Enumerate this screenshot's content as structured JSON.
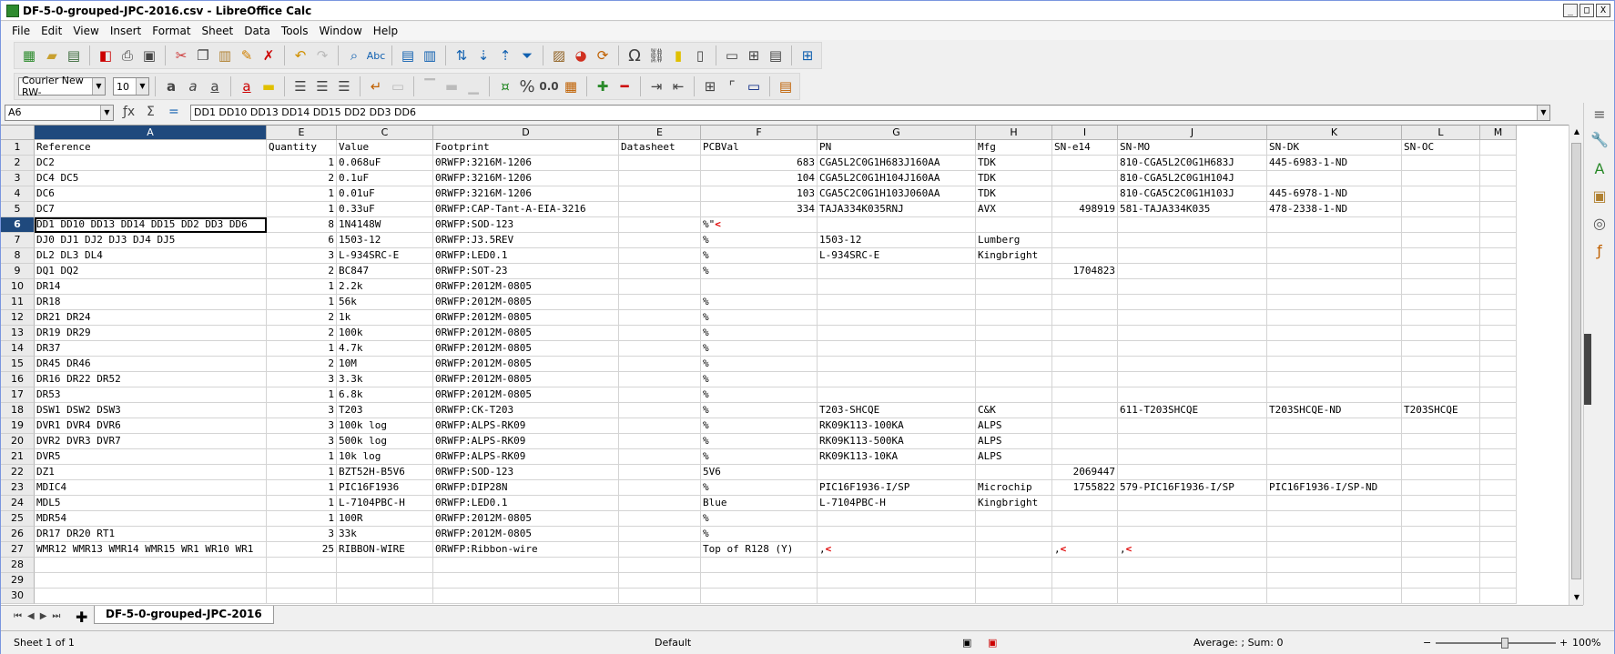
{
  "window": {
    "title": "DF-5-0-grouped-JPC-2016.csv - LibreOffice Calc",
    "min": "_",
    "max": "□",
    "close": "X"
  },
  "menu": [
    "File",
    "Edit",
    "View",
    "Insert",
    "Format",
    "Sheet",
    "Data",
    "Tools",
    "Window",
    "Help"
  ],
  "toolbar": {
    "font_name": "Courier New RW-",
    "font_size": "10",
    "percent": "%",
    "number": "0.0"
  },
  "formula_bar": {
    "cell_ref": "A6",
    "content": "DD1 DD10 DD13 DD14 DD15 DD2 DD3 DD6"
  },
  "columns": [
    {
      "label": "A",
      "w": 255
    },
    {
      "label": "E",
      "w": 77
    },
    {
      "label": "C",
      "w": 106
    },
    {
      "label": "D",
      "w": 204
    },
    {
      "label": "E",
      "w": 90
    },
    {
      "label": "F",
      "w": 128
    },
    {
      "label": "G",
      "w": 174
    },
    {
      "label": "H",
      "w": 84
    },
    {
      "label": "I",
      "w": 72
    },
    {
      "label": "J",
      "w": 164
    },
    {
      "label": "K",
      "w": 148
    },
    {
      "label": "L",
      "w": 86
    },
    {
      "label": "M",
      "w": 40
    }
  ],
  "rows": [
    [
      "Reference",
      "Quantity",
      "Value",
      "Footprint",
      "Datasheet",
      "PCBVal",
      "PN",
      "Mfg",
      "SN-e14",
      "SN-MO",
      "SN-DK",
      "SN-OC",
      ""
    ],
    [
      "DC2",
      "1",
      "0.068uF",
      "0RWFP:3216M-1206",
      "",
      "683",
      "CGA5L2C0G1H683J160AA",
      "TDK",
      "",
      "810-CGA5L2C0G1H683J",
      "445-6983-1-ND",
      "",
      ""
    ],
    [
      "DC4 DC5",
      "2",
      "0.1uF",
      "0RWFP:3216M-1206",
      "",
      "104",
      "CGA5L2C0G1H104J160AA",
      "TDK",
      "",
      "810-CGA5L2C0G1H104J",
      "",
      "",
      ""
    ],
    [
      "DC6",
      "1",
      "0.01uF",
      "0RWFP:3216M-1206",
      "",
      "103",
      "CGA5C2C0G1H103J060AA",
      "TDK",
      "",
      "810-CGA5C2C0G1H103J",
      "445-6978-1-ND",
      "",
      ""
    ],
    [
      "DC7",
      "1",
      "0.33uF",
      "0RWFP:CAP-Tant-A-EIA-3216",
      "",
      "334",
      "TAJA334K035RNJ",
      "AVX",
      "498919",
      "581-TAJA334K035",
      "478-2338-1-ND",
      "",
      ""
    ],
    [
      "DD1 DD10 DD13 DD14 DD15 DD2 DD3 DD6",
      "8",
      "1N4148W",
      "0RWFP:SOD-123",
      "",
      "%\"<",
      "",
      "",
      "",
      "",
      "",
      "",
      ""
    ],
    [
      "DJ0 DJ1 DJ2 DJ3 DJ4 DJ5",
      "6",
      "1503-12",
      "0RWFP:J3.5REV",
      "",
      "%",
      "1503-12",
      "Lumberg",
      "",
      "",
      "",
      "",
      ""
    ],
    [
      "DL2 DL3 DL4",
      "3",
      "L-934SRC-E",
      "0RWFP:LED0.1",
      "",
      "%",
      "L-934SRC-E",
      "Kingbright",
      "",
      "",
      "",
      "",
      ""
    ],
    [
      "DQ1 DQ2",
      "2",
      "BC847",
      "0RWFP:SOT-23",
      "",
      "%",
      "",
      "",
      "1704823",
      "",
      "",
      "",
      ""
    ],
    [
      "DR14",
      "1",
      "2.2k",
      "0RWFP:2012M-0805",
      "",
      "",
      "",
      "",
      "",
      "",
      "",
      "",
      ""
    ],
    [
      "DR18",
      "1",
      "56k",
      "0RWFP:2012M-0805",
      "",
      "%",
      "",
      "",
      "",
      "",
      "",
      "",
      ""
    ],
    [
      "DR21 DR24",
      "2",
      "1k",
      "0RWFP:2012M-0805",
      "",
      "%",
      "",
      "",
      "",
      "",
      "",
      "",
      ""
    ],
    [
      "DR19 DR29",
      "2",
      "100k",
      "0RWFP:2012M-0805",
      "",
      "%",
      "",
      "",
      "",
      "",
      "",
      "",
      ""
    ],
    [
      "DR37",
      "1",
      "4.7k",
      "0RWFP:2012M-0805",
      "",
      "%",
      "",
      "",
      "",
      "",
      "",
      "",
      ""
    ],
    [
      "DR45 DR46",
      "2",
      "10M",
      "0RWFP:2012M-0805",
      "",
      "%",
      "",
      "",
      "",
      "",
      "",
      "",
      ""
    ],
    [
      "DR16 DR22 DR52",
      "3",
      "3.3k",
      "0RWFP:2012M-0805",
      "",
      "%",
      "",
      "",
      "",
      "",
      "",
      "",
      ""
    ],
    [
      "DR53",
      "1",
      "6.8k",
      "0RWFP:2012M-0805",
      "",
      "%",
      "",
      "",
      "",
      "",
      "",
      "",
      ""
    ],
    [
      "DSW1 DSW2 DSW3",
      "3",
      "T203",
      "0RWFP:CK-T203",
      "",
      "%",
      "T203-SHCQE",
      "C&K",
      "",
      "611-T203SHCQE",
      "T203SHCQE-ND",
      "T203SHCQE",
      ""
    ],
    [
      "DVR1 DVR4 DVR6",
      "3",
      "100k log",
      "0RWFP:ALPS-RK09",
      "",
      "%",
      "RK09K113-100KA",
      "ALPS",
      "",
      "",
      "",
      "",
      ""
    ],
    [
      "DVR2 DVR3 DVR7",
      "3",
      "500k log",
      "0RWFP:ALPS-RK09",
      "",
      "%",
      "RK09K113-500KA",
      "ALPS",
      "",
      "",
      "",
      "",
      ""
    ],
    [
      "DVR5",
      "1",
      "10k log",
      "0RWFP:ALPS-RK09",
      "",
      "%",
      "RK09K113-10KA",
      "ALPS",
      "",
      "",
      "",
      "",
      ""
    ],
    [
      "DZ1",
      "1",
      "BZT52H-B5V6",
      "0RWFP:SOD-123",
      "",
      "5V6",
      "",
      "",
      "2069447",
      "",
      "",
      "",
      ""
    ],
    [
      "MDIC4",
      "1",
      "PIC16F1936",
      "0RWFP:DIP28N",
      "",
      "%",
      "PIC16F1936-I/SP",
      "Microchip",
      "1755822",
      "579-PIC16F1936-I/SP",
      "PIC16F1936-I/SP-ND",
      "",
      ""
    ],
    [
      "MDL5",
      "1",
      "L-7104PBC-H",
      "0RWFP:LED0.1",
      "",
      "Blue",
      "L-7104PBC-H",
      "Kingbright",
      "",
      "",
      "",
      "",
      ""
    ],
    [
      "MDR54",
      "1",
      "100R",
      "0RWFP:2012M-0805",
      "",
      "%",
      "",
      "",
      "",
      "",
      "",
      "",
      ""
    ],
    [
      "DR17 DR20 RT1",
      "3",
      "33k",
      "0RWFP:2012M-0805",
      "",
      "%",
      "",
      "",
      "",
      "",
      "",
      "",
      ""
    ],
    [
      "WMR12 WMR13 WMR14 WMR15 WR1 WR10 WR1",
      "25",
      "RIBBON-WIRE",
      "0RWFP:Ribbon-wire",
      "",
      "Top of R128 (Y)",
      ",<",
      "",
      ",<",
      ",<",
      "",
      "",
      ""
    ],
    [
      "",
      "",
      "",
      "",
      "",
      "",
      "",
      "",
      "",
      "",
      "",
      "",
      ""
    ],
    [
      "",
      "",
      "",
      "",
      "",
      "",
      "",
      "",
      "",
      "",
      "",
      "",
      ""
    ],
    [
      "",
      "",
      "",
      "",
      "",
      "",
      "",
      "",
      "",
      "",
      "",
      "",
      ""
    ]
  ],
  "sheet_tab": "DF-5-0-grouped-JPC-2016",
  "status": {
    "sheet": "Sheet 1 of 1",
    "style": "Default",
    "summary": "Average: ; Sum: 0",
    "zoom": "100%"
  }
}
